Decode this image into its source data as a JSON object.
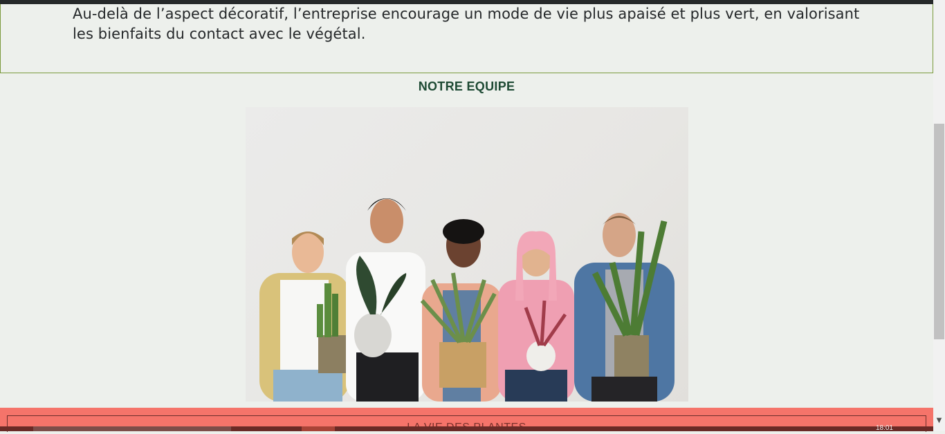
{
  "intro": {
    "text": "Au-delà de l’aspect décoratif, l’entreprise encourage un mode de vie plus apaisé et plus vert, en valorisant les bienfaits du contact avec le végétal."
  },
  "team": {
    "title": "NOTRE EQUIPE",
    "photo_icon": "team-photo"
  },
  "footer": {
    "title": "LA VIE DES PLANTES",
    "clock": "18:01"
  },
  "colors": {
    "background": "#edf0ec",
    "border_green": "#7a9a3c",
    "title_green": "#1e4a34",
    "footer_coral": "#f5746a",
    "footer_text": "#7a302b"
  }
}
